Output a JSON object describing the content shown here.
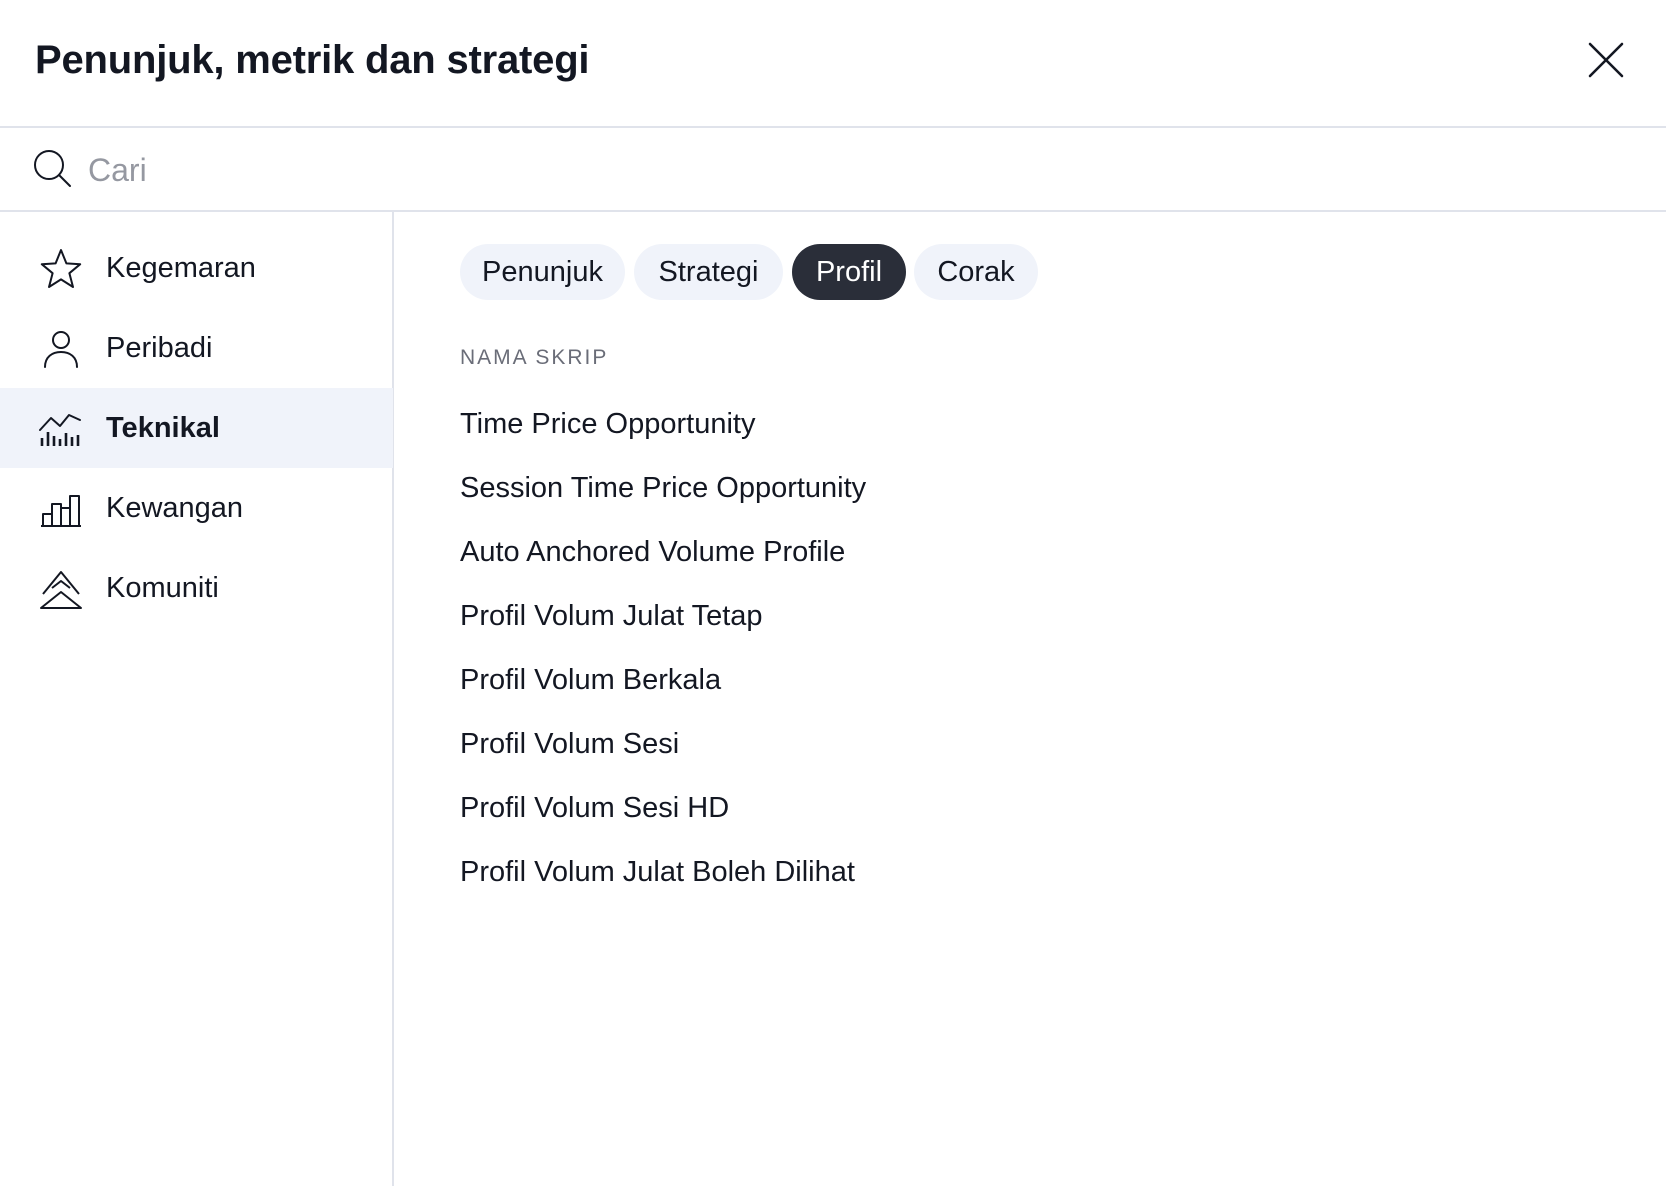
{
  "dialog": {
    "title": "Penunjuk, metrik dan strategi"
  },
  "search": {
    "placeholder": "Cari",
    "value": ""
  },
  "sidebar": {
    "items": [
      {
        "label": "Kegemaran",
        "icon": "star-icon",
        "active": false
      },
      {
        "label": "Peribadi",
        "icon": "user-icon",
        "active": false
      },
      {
        "label": "Teknikal",
        "icon": "technical-chart-icon",
        "active": true
      },
      {
        "label": "Kewangan",
        "icon": "bar-chart-icon",
        "active": false
      },
      {
        "label": "Komuniti",
        "icon": "community-icon",
        "active": false
      }
    ]
  },
  "tabs": [
    {
      "label": "Penunjuk",
      "active": false
    },
    {
      "label": "Strategi",
      "active": false
    },
    {
      "label": "Profil",
      "active": true
    },
    {
      "label": "Corak",
      "active": false
    }
  ],
  "list": {
    "header": "NAMA SKRIP",
    "items": [
      "Time Price Opportunity",
      "Session Time Price Opportunity",
      "Auto Anchored Volume Profile",
      "Profil Volum Julat Tetap",
      "Profil Volum Berkala",
      "Profil Volum Sesi",
      "Profil Volum Sesi HD",
      "Profil Volum Julat Boleh Dilihat"
    ]
  },
  "colors": {
    "text": "#131722",
    "muted": "#6a6d78",
    "placeholder": "#9598a1",
    "divider": "#e0e3eb",
    "active_bg": "#f0f3fa",
    "chip_active": "#2a2e39"
  }
}
